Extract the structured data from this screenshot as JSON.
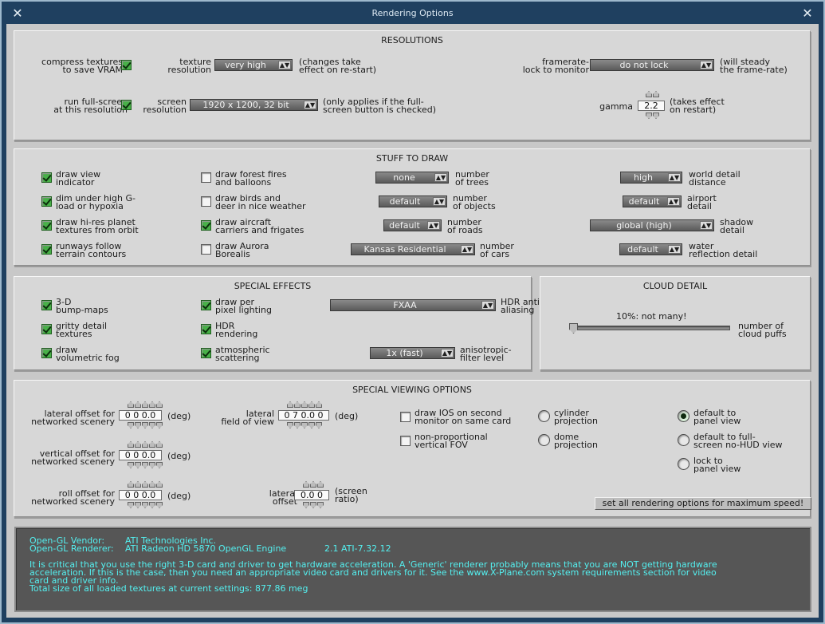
{
  "window": {
    "title": "Rendering Options",
    "close_left": "✕",
    "close_right": "✕"
  },
  "resolutions": {
    "title": "RESOLUTIONS",
    "compress_textures": {
      "label1": "compress textures",
      "label2": "to save VRAM",
      "checked": true
    },
    "texture_res": {
      "label1": "texture",
      "label2": "resolution",
      "value": "very high",
      "note1": "(changes take",
      "note2": "effect on re-start)"
    },
    "framerate_lock": {
      "label1": "framerate-",
      "label2": "lock to monitor",
      "value": "do not lock",
      "note1": "(will steady",
      "note2": "the frame-rate)"
    },
    "fullscreen": {
      "label1": "run full-screen",
      "label2": "at this resolution",
      "checked": true
    },
    "screen_res": {
      "label1": "screen",
      "label2": "resolution",
      "value": "1920 x 1200, 32 bit",
      "note1": "(only applies if the full-",
      "note2": "screen button is checked)"
    },
    "gamma": {
      "label": "gamma",
      "value": "2.2",
      "note1": "(takes effect",
      "note2": "on restart)"
    }
  },
  "stuff": {
    "title": "STUFF TO DRAW",
    "checks": [
      {
        "l1": "draw view",
        "l2": "indicator",
        "checked": true
      },
      {
        "l1": "dim under high G-",
        "l2": "load or hypoxia",
        "checked": true
      },
      {
        "l1": "draw hi-res planet",
        "l2": "textures from orbit",
        "checked": true
      },
      {
        "l1": "runways follow",
        "l2": "terrain contours",
        "checked": true
      },
      {
        "l1": "draw forest fires",
        "l2": "and balloons",
        "checked": false
      },
      {
        "l1": "draw birds and",
        "l2": "deer in nice weather",
        "checked": false
      },
      {
        "l1": "draw aircraft",
        "l2": "carriers and frigates",
        "checked": true
      },
      {
        "l1": "draw Aurora",
        "l2": "Borealis",
        "checked": false
      }
    ],
    "dropdowns": [
      {
        "value": "none",
        "l1": "number",
        "l2": "of trees"
      },
      {
        "value": "default",
        "l1": "number",
        "l2": "of objects"
      },
      {
        "value": "default",
        "l1": "number",
        "l2": "of roads"
      },
      {
        "value": "Kansas Residential",
        "l1": "number",
        "l2": "of cars"
      },
      {
        "value": "high",
        "l1": "world detail",
        "l2": "distance"
      },
      {
        "value": "default",
        "l1": "airport",
        "l2": "detail"
      },
      {
        "value": "global (high)",
        "l1": "shadow",
        "l2": "detail"
      },
      {
        "value": "default",
        "l1": "water",
        "l2": "reflection detail"
      }
    ]
  },
  "effects": {
    "title": "SPECIAL EFFECTS",
    "checks": [
      {
        "l1": "3-D",
        "l2": "bump-maps",
        "checked": true
      },
      {
        "l1": "gritty detail",
        "l2": "textures",
        "checked": true
      },
      {
        "l1": "draw",
        "l2": "volumetric fog",
        "checked": true
      },
      {
        "l1": "draw per",
        "l2": "pixel lighting",
        "checked": true
      },
      {
        "l1": "HDR",
        "l2": "rendering",
        "checked": true
      },
      {
        "l1": "atmospheric",
        "l2": "scattering",
        "checked": true
      }
    ],
    "antialias": {
      "value": "FXAA",
      "l1": "HDR anti-",
      "l2": "aliasing"
    },
    "aniso": {
      "value": "1x (fast)",
      "l1": "anisotropic-",
      "l2": "filter level"
    }
  },
  "clouds": {
    "title": "CLOUD DETAIL",
    "value_text": "10%: not many!",
    "l1": "number of",
    "l2": "cloud puffs",
    "level": 0.1
  },
  "viewing": {
    "title": "SPECIAL VIEWING OPTIONS",
    "lateral_offset": {
      "l1": "lateral offset for",
      "l2": "networked scenery",
      "value": "0 0 0.0",
      "unit": "(deg)"
    },
    "vertical_offset": {
      "l1": "vertical offset for",
      "l2": "networked scenery",
      "value": "0 0 0.0",
      "unit": "(deg)"
    },
    "roll_offset": {
      "l1": "roll offset for",
      "l2": "networked scenery",
      "value": "0 0 0.0",
      "unit": "(deg)"
    },
    "lateral_fov": {
      "l1": "lateral",
      "l2": "field of view",
      "value": "0 7 0.0 0",
      "unit": "(deg)"
    },
    "lateral_off": {
      "l1": "lateral",
      "l2": "offset",
      "value": "0.0 0",
      "u1": "(screen",
      "u2": "ratio)"
    },
    "ios": {
      "l1": "draw IOS on second",
      "l2": "monitor on same card",
      "checked": false
    },
    "nonprop": {
      "l1": "non-proportional",
      "l2": "vertical FOV",
      "checked": false
    },
    "cylinder": {
      "l1": "cylinder",
      "l2": "projection",
      "on": false
    },
    "dome": {
      "l1": "dome",
      "l2": "projection",
      "on": false
    },
    "panel": {
      "l1": "default to",
      "l2": "panel view",
      "on": true
    },
    "fullscreen_nohud": {
      "l1": "default to full-",
      "l2": "screen no-HUD view",
      "on": false
    },
    "lock_panel": {
      "l1": "lock to",
      "l2": "panel view",
      "on": false
    },
    "max_speed": "set all rendering options for maximum speed!"
  },
  "info": {
    "vendor_label": "Open-GL Vendor:",
    "vendor": "ATI Technologies Inc.",
    "renderer_label": "Open-GL Renderer:",
    "renderer": "ATI Radeon HD 5870 OpenGL Engine",
    "version": "2.1 ATI-7.32.12",
    "line1": "It is critical that you use the right 3-D card and driver to get hardware acceleration. A 'Generic' renderer probably means that you are NOT getting hardware",
    "line2": "acceleration. If this is the case, then you need an appropriate video card and drivers for it. See the www.X-Plane.com system requirements section for video",
    "line3": "card and driver info.",
    "line4": "Total size of all loaded textures at current settings: 877.86 meg"
  }
}
